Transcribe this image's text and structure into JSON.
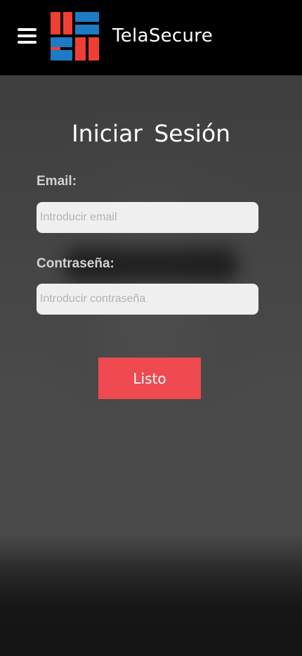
{
  "header": {
    "brand_name": "TelaSecure",
    "menu_icon": "hamburger-menu-icon",
    "logo_icon": "telasecure-brick-logo",
    "logo_colors": {
      "red": "#ef3e33",
      "blue": "#1d7ac4"
    }
  },
  "login": {
    "title": "Iniciar Sesión",
    "email_label": "Email:",
    "email_placeholder": "Introducir email",
    "email_value": "",
    "password_label": "Contraseña:",
    "password_placeholder": "Introducir contraseña",
    "password_value": "",
    "submit_label": "Listo",
    "submit_color": "#ee4a50"
  }
}
